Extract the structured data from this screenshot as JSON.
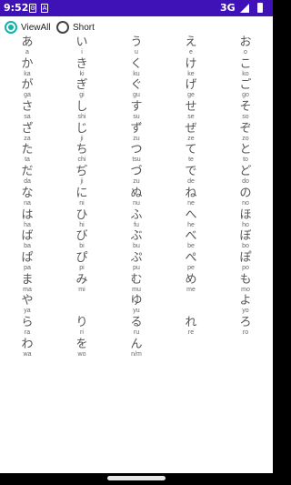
{
  "status_bar": {
    "time": "9:52",
    "notif_icon_1": "gear-icon",
    "notif_icon_2": "A",
    "network": "3G",
    "bg_color": "#3f12b8"
  },
  "view_mode": {
    "options": [
      {
        "label": "ViewAll",
        "checked": true
      },
      {
        "label": "Short",
        "checked": false
      }
    ],
    "accent_color": "#12b3a8"
  },
  "rows": [
    [
      {
        "k": "あ",
        "r": "a"
      },
      {
        "k": "い",
        "r": "i"
      },
      {
        "k": "う",
        "r": "u"
      },
      {
        "k": "え",
        "r": "e"
      },
      {
        "k": "お",
        "r": "o"
      }
    ],
    [
      {
        "k": "か",
        "r": "ka"
      },
      {
        "k": "き",
        "r": "ki"
      },
      {
        "k": "く",
        "r": "ku"
      },
      {
        "k": "け",
        "r": "ke"
      },
      {
        "k": "こ",
        "r": "ko"
      }
    ],
    [
      {
        "k": "が",
        "r": "ga"
      },
      {
        "k": "ぎ",
        "r": "gi"
      },
      {
        "k": "ぐ",
        "r": "gu"
      },
      {
        "k": "げ",
        "r": "ge"
      },
      {
        "k": "ご",
        "r": "go"
      }
    ],
    [
      {
        "k": "さ",
        "r": "sa"
      },
      {
        "k": "し",
        "r": "shi"
      },
      {
        "k": "す",
        "r": "su"
      },
      {
        "k": "せ",
        "r": "se"
      },
      {
        "k": "そ",
        "r": "so"
      }
    ],
    [
      {
        "k": "ざ",
        "r": "za"
      },
      {
        "k": "じ",
        "r": "ji"
      },
      {
        "k": "ず",
        "r": "zu"
      },
      {
        "k": "ぜ",
        "r": "ze"
      },
      {
        "k": "ぞ",
        "r": "zo"
      }
    ],
    [
      {
        "k": "た",
        "r": "ta"
      },
      {
        "k": "ち",
        "r": "chi"
      },
      {
        "k": "つ",
        "r": "tsu"
      },
      {
        "k": "て",
        "r": "te"
      },
      {
        "k": "と",
        "r": "to"
      }
    ],
    [
      {
        "k": "だ",
        "r": "da"
      },
      {
        "k": "ぢ",
        "r": "ji"
      },
      {
        "k": "づ",
        "r": "zu"
      },
      {
        "k": "で",
        "r": "de"
      },
      {
        "k": "ど",
        "r": "do"
      }
    ],
    [
      {
        "k": "な",
        "r": "na"
      },
      {
        "k": "に",
        "r": "ni"
      },
      {
        "k": "ぬ",
        "r": "nu"
      },
      {
        "k": "ね",
        "r": "ne"
      },
      {
        "k": "の",
        "r": "no"
      }
    ],
    [
      {
        "k": "は",
        "r": "ha"
      },
      {
        "k": "ひ",
        "r": "hi"
      },
      {
        "k": "ふ",
        "r": "fu"
      },
      {
        "k": "へ",
        "r": "he"
      },
      {
        "k": "ほ",
        "r": "ho"
      }
    ],
    [
      {
        "k": "ば",
        "r": "ba"
      },
      {
        "k": "び",
        "r": "bi"
      },
      {
        "k": "ぶ",
        "r": "bu"
      },
      {
        "k": "べ",
        "r": "be"
      },
      {
        "k": "ぼ",
        "r": "bo"
      }
    ],
    [
      {
        "k": "ぱ",
        "r": "pa"
      },
      {
        "k": "ぴ",
        "r": "pi"
      },
      {
        "k": "ぷ",
        "r": "pu"
      },
      {
        "k": "ぺ",
        "r": "pe"
      },
      {
        "k": "ぽ",
        "r": "po"
      }
    ],
    [
      {
        "k": "ま",
        "r": "ma"
      },
      {
        "k": "み",
        "r": "mi"
      },
      {
        "k": "む",
        "r": "mu"
      },
      {
        "k": "め",
        "r": "me"
      },
      {
        "k": "も",
        "r": "mo"
      }
    ],
    [
      {
        "k": "や",
        "r": "ya"
      },
      null,
      {
        "k": "ゆ",
        "r": "yu"
      },
      null,
      {
        "k": "よ",
        "r": "yo"
      }
    ],
    [
      {
        "k": "ら",
        "r": "ra"
      },
      {
        "k": "り",
        "r": "ri"
      },
      {
        "k": "る",
        "r": "ru"
      },
      {
        "k": "れ",
        "r": "re"
      },
      {
        "k": "ろ",
        "r": "ro"
      }
    ],
    [
      {
        "k": "わ",
        "r": "wa"
      },
      {
        "k": "を",
        "r": "wo"
      },
      {
        "k": "ん",
        "r": "n/m"
      },
      null,
      null
    ]
  ]
}
